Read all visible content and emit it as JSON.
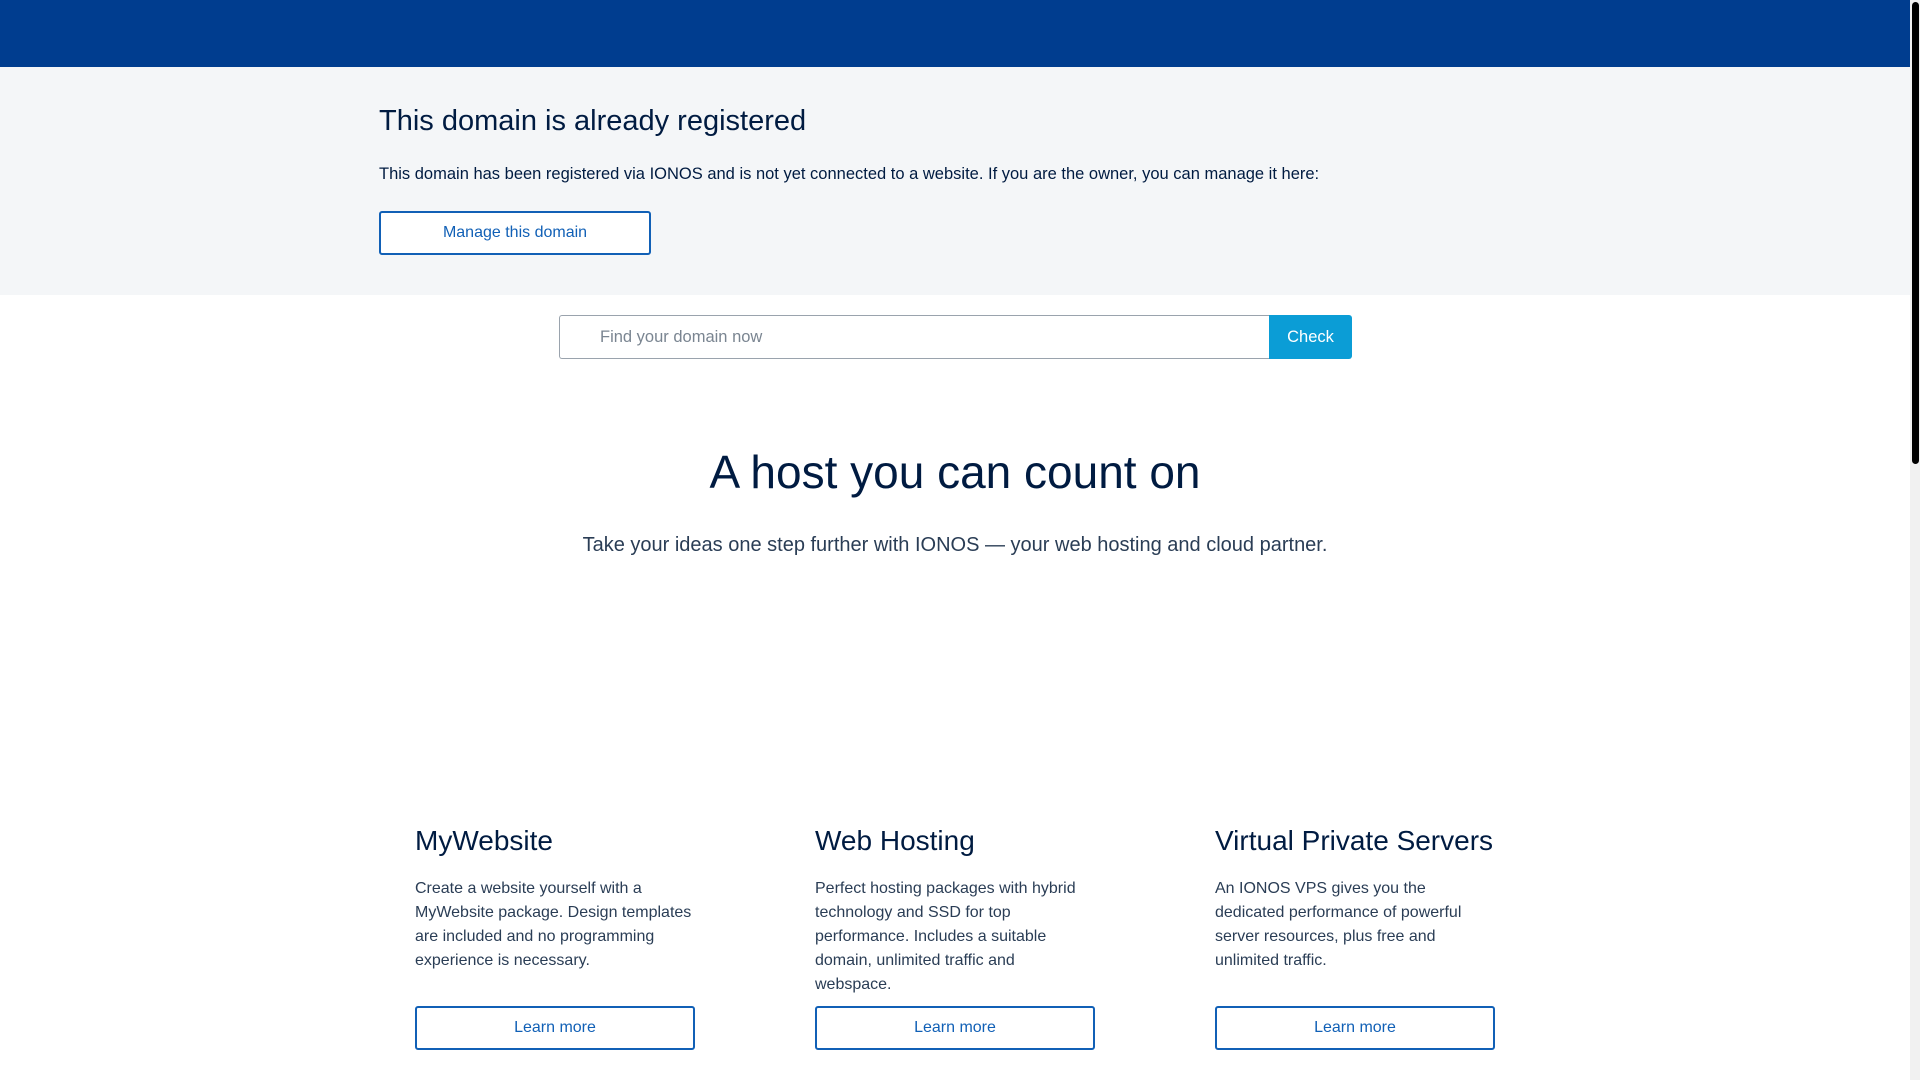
{
  "header": {
    "bg_color": "#003d8f"
  },
  "notice": {
    "title": "This domain is already registered",
    "text": "This domain has been registered via IONOS and is not yet connected to a website. If you are the owner, you can manage it here:",
    "manage_label": "Manage this domain"
  },
  "search": {
    "placeholder": "Find your domain now",
    "value": "",
    "check_label": "Check"
  },
  "hero": {
    "title": "A host you can count on",
    "subtitle": "Take your ideas one step further with IONOS — your web hosting and cloud partner."
  },
  "cards": [
    {
      "title": "MyWebsite",
      "text": "Create a website yourself with a MyWebsite package. Design templates are included and no programming experience is necessary.",
      "button": "Learn more"
    },
    {
      "title": "Web Hosting",
      "text": "Perfect hosting packages with hybrid technology and SSD for top performance. Includes a suitable domain, unlimited traffic and webspace.",
      "button": "Learn more"
    },
    {
      "title": "Virtual Private Servers",
      "text": "An IONOS VPS gives you the dedicated performance of powerful server resources, plus free and unlimited traffic.",
      "button": "Learn more"
    }
  ],
  "colors": {
    "primary_blue": "#1160b6",
    "check_button": "#0b9dd6",
    "notice_bg": "#f4f6f8",
    "text_dark": "#001b41"
  }
}
